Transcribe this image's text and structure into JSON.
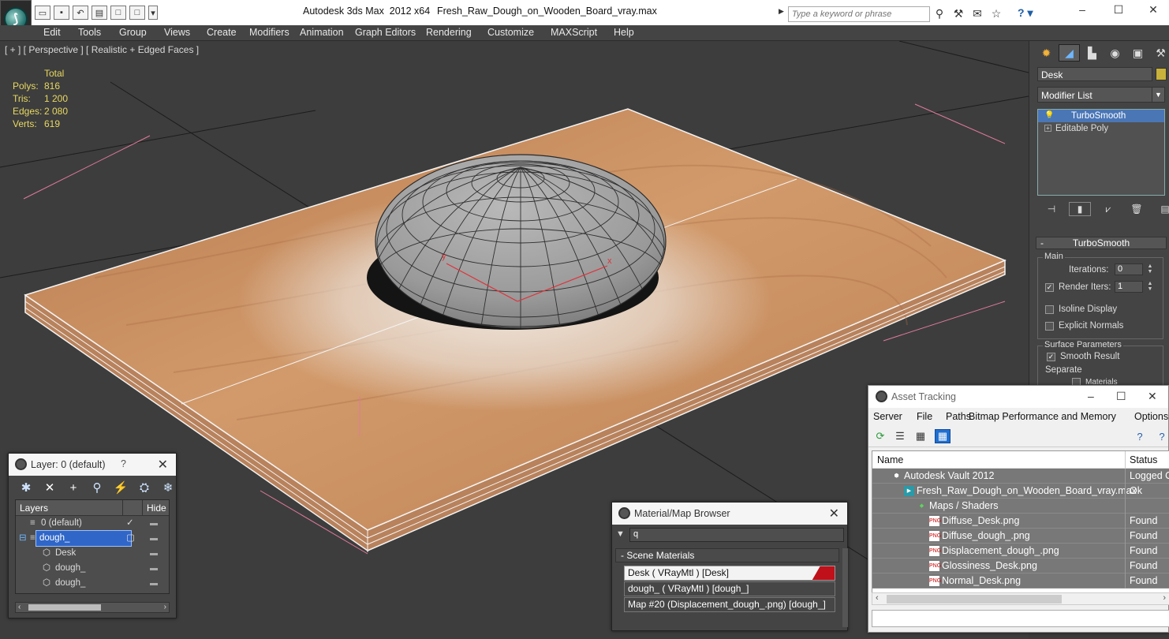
{
  "titlebar": {
    "app_title": "Autodesk 3ds Max  2012 x64",
    "file_name": "Fresh_Raw_Dough_on_Wooden_Board_vray.max",
    "search_placeholder": "Type a keyword or phrase",
    "app_logo": "3ds-max-logo"
  },
  "menu": [
    "Edit",
    "Tools",
    "Group",
    "Views",
    "Create",
    "Modifiers",
    "Animation",
    "Graph Editors",
    "Rendering",
    "Customize",
    "MAXScript",
    "Help"
  ],
  "viewport": {
    "label": "[ + ] [ Perspective ] [ Realistic + Edged Faces ]",
    "stats": {
      "header": "Total",
      "polys_label": "Polys:",
      "polys": "816",
      "tris_label": "Tris:",
      "tris": "1 200",
      "edges_label": "Edges:",
      "edges": "2 080",
      "verts_label": "Verts:",
      "verts": "619"
    },
    "gizmo_x": "x",
    "gizmo_y": "y",
    "colors": {
      "stats": "#e8d860",
      "background": "#3d3d3d",
      "wood": "#c58a5c"
    }
  },
  "command_panel": {
    "object_name": "Desk",
    "object_color": "#c9b23b",
    "modifier_list": "Modifier List",
    "stack": [
      "TurboSmooth",
      "Editable Poly"
    ],
    "rollout_title": "TurboSmooth",
    "main_group": "Main",
    "iterations_label": "Iterations:",
    "iterations_value": "0",
    "render_iters_label": "Render Iters:",
    "render_iters_value": "1",
    "isoline_label": "Isoline Display",
    "explicit_normals_label": "Explicit Normals",
    "surface_group": "Surface Parameters",
    "smooth_result_label": "Smooth Result",
    "separate_label": "Separate",
    "materials_label": "Materials"
  },
  "layer_dialog": {
    "title": "Layer: 0 (default)",
    "help": "?",
    "col_layers": "Layers",
    "col_hide": "Hide",
    "rows": [
      {
        "name": "0 (default)"
      },
      {
        "name": "dough_"
      },
      {
        "name": "Desk"
      },
      {
        "name": "dough_"
      },
      {
        "name": "dough_"
      }
    ]
  },
  "material_browser": {
    "title": "Material/Map Browser",
    "search_value": "q",
    "group": "Scene Materials",
    "items": [
      "Desk  ( VRayMtl ) [Desk]",
      "dough_  ( VRayMtl ) [dough_]",
      "Map #20 (Displacement_dough_.png) [dough_]"
    ]
  },
  "asset_tracking": {
    "title": "Asset Tracking",
    "menu": [
      "Server",
      "File",
      "Paths",
      "Bitmap Performance and Memory",
      "Options"
    ],
    "col_name": "Name",
    "col_status": "Status",
    "rows": [
      {
        "name": "Autodesk Vault 2012",
        "status": "Logged O"
      },
      {
        "name": "Fresh_Raw_Dough_on_Wooden_Board_vray.max",
        "status": "Ok"
      },
      {
        "name": "Maps / Shaders",
        "status": ""
      },
      {
        "name": "Diffuse_Desk.png",
        "status": "Found"
      },
      {
        "name": "Diffuse_dough_.png",
        "status": "Found"
      },
      {
        "name": "Displacement_dough_.png",
        "status": "Found"
      },
      {
        "name": "Glossiness_Desk.png",
        "status": "Found"
      },
      {
        "name": "Normal_Desk.png",
        "status": "Found"
      }
    ]
  }
}
